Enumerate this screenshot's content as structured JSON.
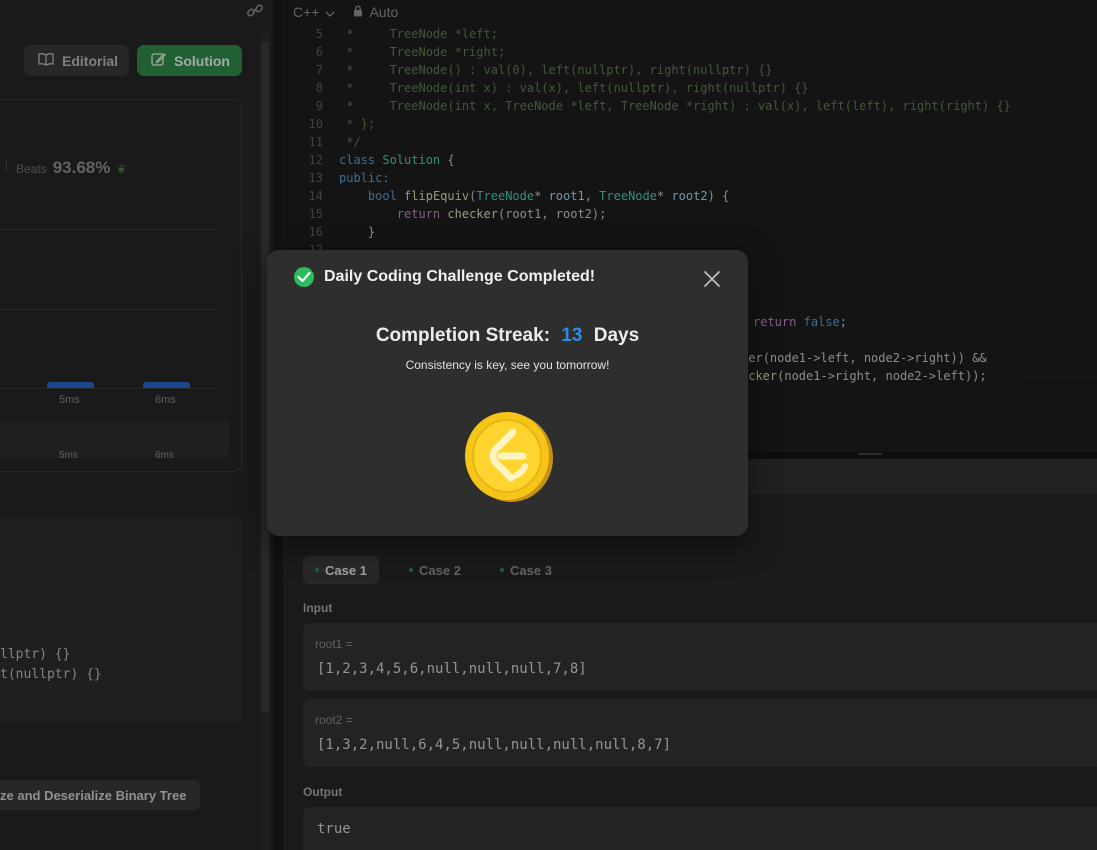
{
  "left_panel": {
    "editorial_label": "Editorial",
    "solution_label": "Solution",
    "beats_label": "Beats",
    "beats_value": "93.68%",
    "chart_ticks": [
      "5ms",
      "6ms"
    ],
    "range_ticks": [
      "5ms",
      "6ms"
    ],
    "code_lines": [
      "llptr) {}",
      "t(nullptr) {}"
    ],
    "related_problem": "ze and Deserialize Binary Tree"
  },
  "editor": {
    "language": "C++",
    "mode": "Auto"
  },
  "testcase": {
    "tabs": [
      {
        "label": "Case 1",
        "active": true
      },
      {
        "label": "Case 2",
        "active": false
      },
      {
        "label": "Case 3",
        "active": false
      }
    ],
    "input_label": "Input",
    "root1_name": "root1 =",
    "root1_value": "[1,2,3,4,5,6,null,null,null,7,8]",
    "root2_name": "root2 =",
    "root2_value": "[1,3,2,null,6,4,5,null,null,null,null,8,7]",
    "output_label": "Output",
    "output_value": "true"
  },
  "modal": {
    "title": "Daily Coding Challenge Completed!",
    "streak_label": "Completion Streak:",
    "streak_value": "13",
    "streak_unit": "Days",
    "subtitle": "Consistency is key, see you tomorrow!"
  },
  "colors": {
    "accent_green": "#2cbb5d",
    "streak_blue": "#2f8be6",
    "coin_gold": "#f5c518"
  }
}
